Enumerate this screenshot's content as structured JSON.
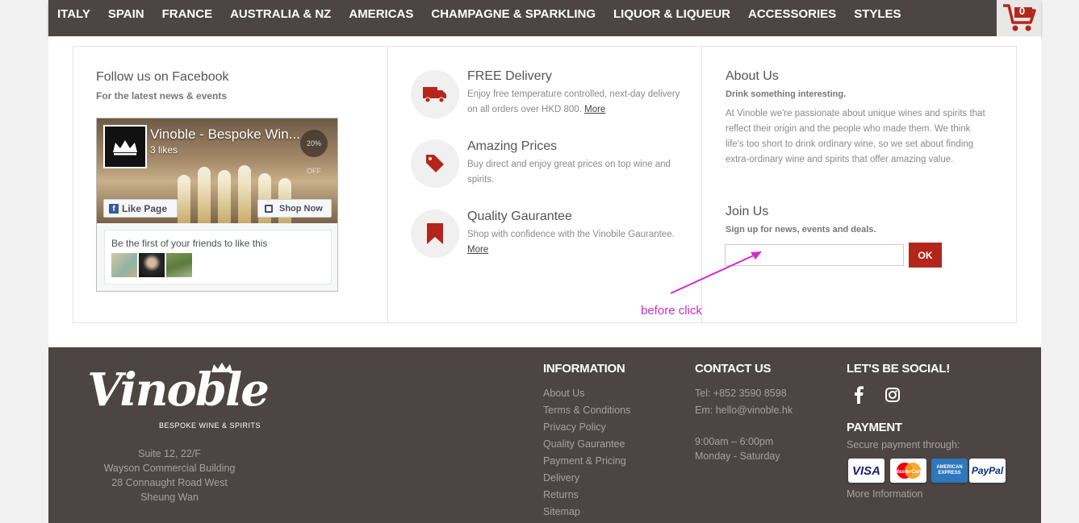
{
  "nav": {
    "items": [
      "ITALY",
      "SPAIN",
      "FRANCE",
      "AUSTRALIA & NZ",
      "AMERICAS",
      "CHAMPAGNE & SPARKLING",
      "LIQUOR & LIQUEUR",
      "ACCESSORIES",
      "STYLES"
    ],
    "cart_count": "0"
  },
  "facebook": {
    "title": "Follow us on Facebook",
    "subtitle": "For the latest news & events",
    "page_name": "Vinoble - Bespoke Win...",
    "likes": "3 likes",
    "badge": "20% OFF",
    "like_button": "Like Page",
    "shop_button": "Shop Now",
    "friends_text": "Be the first of your friends to like this"
  },
  "features": [
    {
      "title": "FREE Delivery",
      "text": "Enjoy free temperature controlled, next-day delivery on all orders over HKD 800.",
      "more": "More",
      "icon": "truck-icon"
    },
    {
      "title": "Amazing Prices",
      "text": "Buy direct and enjoy great prices on top wine and spirits.",
      "more": "",
      "icon": "price-tag-icon"
    },
    {
      "title": "Quality Gaurantee",
      "text": "Shop with confidence with the Vinobile Gaurantee.",
      "more": "More",
      "icon": "bookmark-icon"
    }
  ],
  "about": {
    "title": "About Us",
    "subtitle": "Drink something interesting.",
    "text": "At Vinoble we're passionate about unique wines and spirits that reflect their origin and the people who made them. We think life's too short to drink ordinary wine, so we set about finding extra-ordinary wine and spirits that offer amazing value."
  },
  "join": {
    "title": "Join Us",
    "subtitle": "Sign up for news, events and deals.",
    "input_value": "",
    "button": "OK"
  },
  "annotation": "before click",
  "footer": {
    "logo_text": "Vinoble",
    "logo_tagline": "BESPOKE WINE & SPIRITS",
    "address": [
      "Suite 12, 22/F",
      "Wayson Commercial Building",
      "28 Connaught Road West",
      "Sheung Wan"
    ],
    "information": {
      "title": "INFORMATION",
      "links": [
        "About Us",
        "Terms & Conditions",
        "Privacy Policy",
        "Quality Gaurantee",
        "Payment & Pricing",
        "Delivery",
        "Returns",
        "Sitemap"
      ]
    },
    "contact": {
      "title": "CONTACT US",
      "tel": "Tel: +852 3590 8598",
      "email": "Em: hello@vinoble.hk",
      "hours": "9:00am – 6:00pm",
      "days": "Monday - Saturday"
    },
    "social": {
      "title": "LET'S BE SOCIAL!",
      "icons": [
        "facebook-icon",
        "instagram-icon"
      ]
    },
    "payment": {
      "title": "PAYMENT",
      "text": "Secure payment through:",
      "cards": [
        "VISA",
        "MasterCard",
        "AMERICAN EXPRESS",
        "PayPal"
      ],
      "more": "More Information"
    }
  },
  "colors": {
    "nav_bg": "#4d4543",
    "accent": "#b4261c",
    "annotation": "#d12bd1"
  }
}
